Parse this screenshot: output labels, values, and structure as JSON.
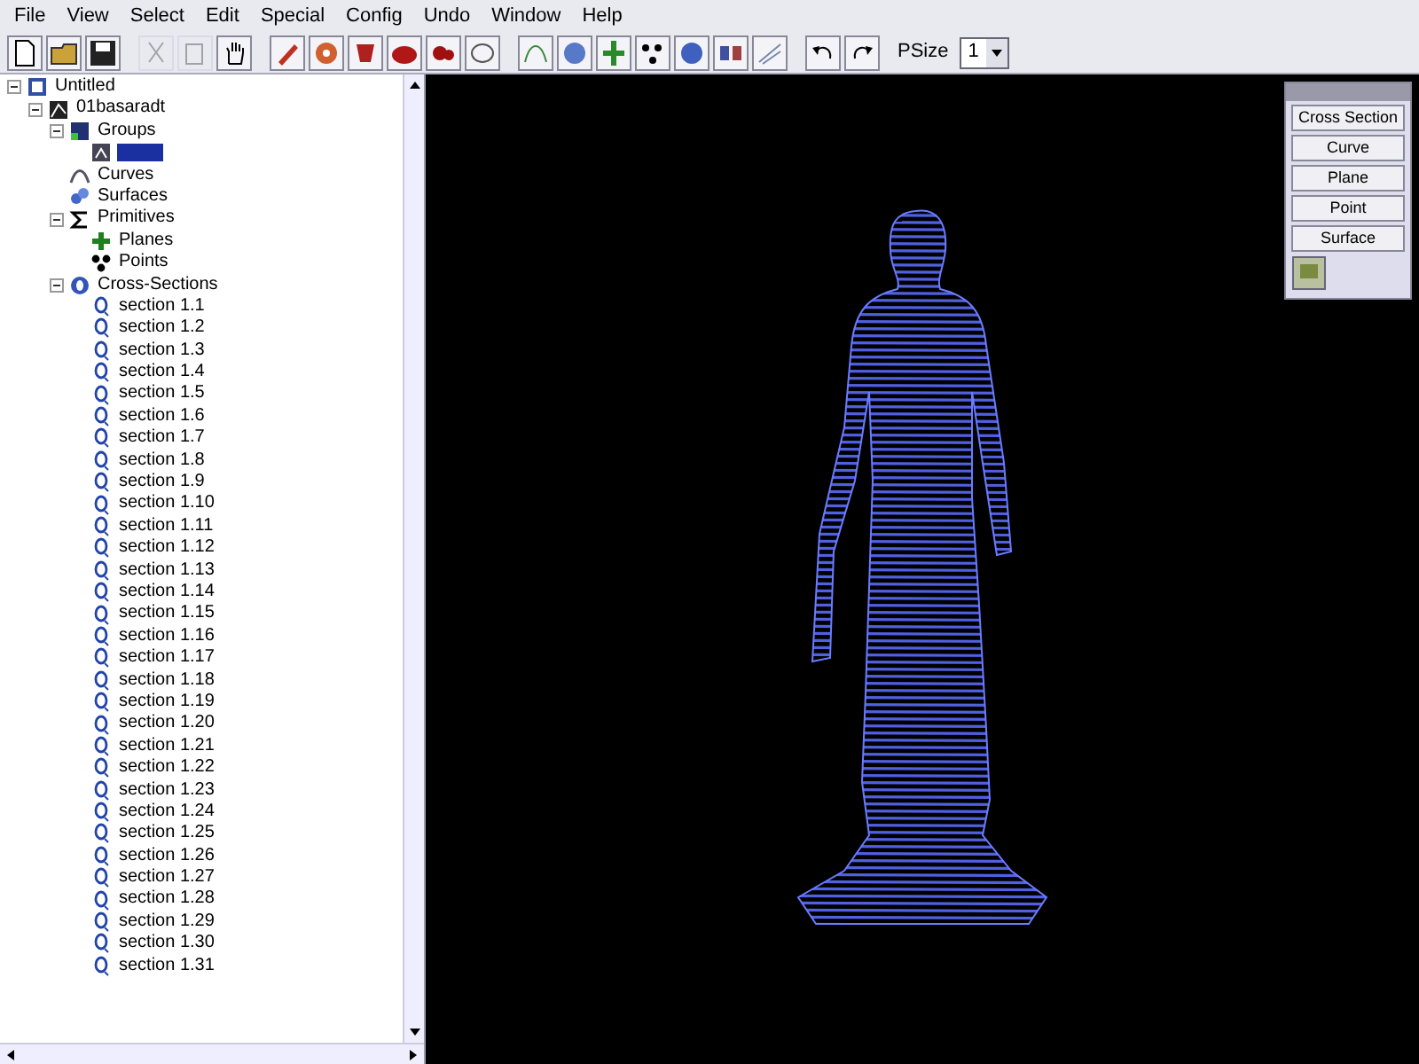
{
  "menu": [
    "File",
    "View",
    "Select",
    "Edit",
    "Special",
    "Config",
    "Undo",
    "Window",
    "Help"
  ],
  "toolbar": [
    {
      "disabled": false
    },
    {
      "disabled": false
    },
    {
      "disabled": false
    },
    {
      "disabled": true
    },
    {
      "disabled": true
    },
    {
      "disabled": false
    },
    {
      "disabled": false
    },
    {
      "disabled": false
    },
    {
      "disabled": false
    },
    {
      "disabled": false
    },
    {
      "disabled": false
    },
    {
      "disabled": false
    },
    {
      "disabled": false
    },
    {
      "disabled": false
    },
    {
      "disabled": false
    },
    {
      "disabled": false
    },
    {
      "disabled": false
    },
    {
      "disabled": false
    },
    {
      "disabled": false
    },
    {
      "disabled": false
    },
    {
      "disabled": false
    }
  ],
  "psize": {
    "label": "PSize",
    "value": "1"
  },
  "tree": [
    {
      "kind": "root",
      "label": "Untitled",
      "expanded": true,
      "children": [
        {
          "kind": "file",
          "label": "01basaradt",
          "expanded": true,
          "children": [
            {
              "kind": "group",
              "label": "Groups",
              "expanded": true,
              "children": [
                {
                  "kind": "item",
                  "selected": true
                }
              ]
            },
            {
              "kind": "curves",
              "label": "Curves"
            },
            {
              "kind": "surfaces",
              "label": "Surfaces"
            },
            {
              "kind": "primitives",
              "label": "Primitives",
              "expanded": true,
              "children": [
                {
                  "kind": "planes",
                  "label": "Planes"
                },
                {
                  "kind": "points",
                  "label": "Points"
                }
              ]
            },
            {
              "kind": "sections",
              "label": "Cross-Sections",
              "expanded": true,
              "children": [
                {
                  "kind": "section",
                  "label": "section 1.1"
                },
                {
                  "kind": "section",
                  "label": "section 1.2"
                },
                {
                  "kind": "section",
                  "label": "section 1.3"
                },
                {
                  "kind": "section",
                  "label": "section 1.4"
                },
                {
                  "kind": "section",
                  "label": "section 1.5"
                },
                {
                  "kind": "section",
                  "label": "section 1.6"
                },
                {
                  "kind": "section",
                  "label": "section 1.7"
                },
                {
                  "kind": "section",
                  "label": "section 1.8"
                },
                {
                  "kind": "section",
                  "label": "section 1.9"
                },
                {
                  "kind": "section",
                  "label": "section 1.10"
                },
                {
                  "kind": "section",
                  "label": "section 1.11"
                },
                {
                  "kind": "section",
                  "label": "section 1.12"
                },
                {
                  "kind": "section",
                  "label": "section 1.13"
                },
                {
                  "kind": "section",
                  "label": "section 1.14"
                },
                {
                  "kind": "section",
                  "label": "section 1.15"
                },
                {
                  "kind": "section",
                  "label": "section 1.16"
                },
                {
                  "kind": "section",
                  "label": "section 1.17"
                },
                {
                  "kind": "section",
                  "label": "section 1.18"
                },
                {
                  "kind": "section",
                  "label": "section 1.19"
                },
                {
                  "kind": "section",
                  "label": "section 1.20"
                },
                {
                  "kind": "section",
                  "label": "section 1.21"
                },
                {
                  "kind": "section",
                  "label": "section 1.22"
                },
                {
                  "kind": "section",
                  "label": "section 1.23"
                },
                {
                  "kind": "section",
                  "label": "section 1.24"
                },
                {
                  "kind": "section",
                  "label": "section 1.25"
                },
                {
                  "kind": "section",
                  "label": "section 1.26"
                },
                {
                  "kind": "section",
                  "label": "section 1.27"
                },
                {
                  "kind": "section",
                  "label": "section 1.28"
                },
                {
                  "kind": "section",
                  "label": "section 1.29"
                },
                {
                  "kind": "section",
                  "label": "section 1.30"
                },
                {
                  "kind": "section",
                  "label": "section 1.31"
                }
              ]
            }
          ]
        }
      ]
    }
  ],
  "palette": {
    "buttons": [
      "Cross Section",
      "Curve",
      "Plane",
      "Point",
      "Surface"
    ]
  }
}
